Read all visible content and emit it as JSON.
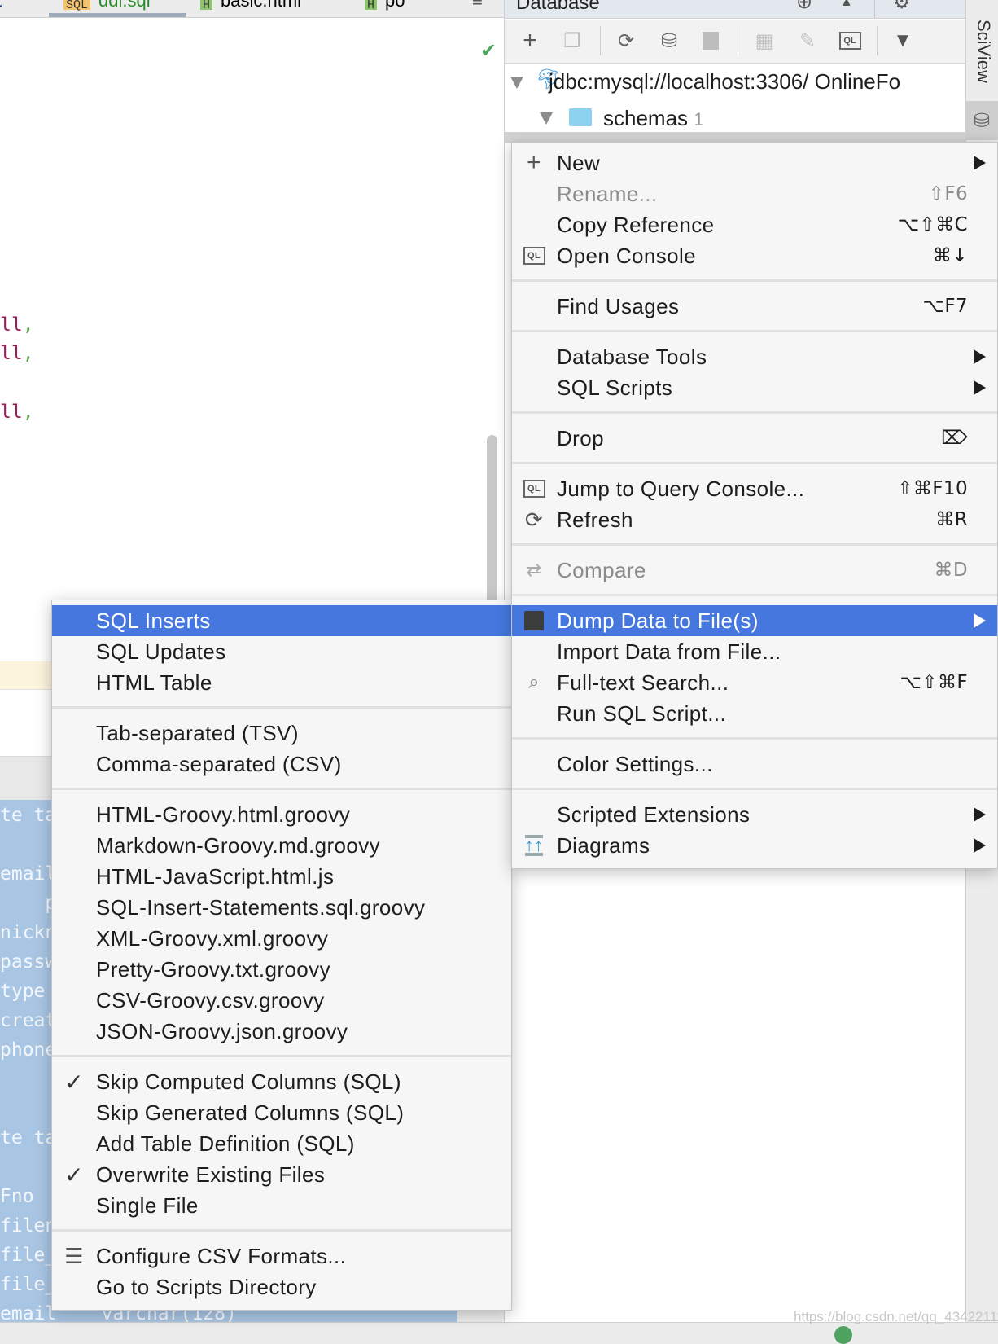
{
  "tabs": [
    {
      "badge": "SQL",
      "label": "ddl.sql",
      "badge_color": "#f5c46d",
      "text_color": "#2a8a2a",
      "active": true
    },
    {
      "badge": "H",
      "label": "basic.html",
      "badge_color": "#8fc46f",
      "text_color": "#222"
    },
    {
      "badge": "H",
      "label": "po",
      "badge_color": "#8fc46f",
      "text_color": "#222"
    }
  ],
  "tab_overflow": "≡",
  "editor": {
    "fragments": [
      {
        "kw": "ll",
        "punct": ","
      },
      {
        "kw": "ll",
        "punct": ","
      },
      {
        "kw": "ll",
        "punct": ","
      }
    ],
    "selected_lines": [
      "te ta",
      "",
      "email",
      "    p",
      "nickn",
      "passw",
      "type",
      "creat",
      "phone",
      "",
      "",
      "te ta",
      "",
      "Fno",
      "filen",
      "file_",
      "file_",
      "email    varchar(128)"
    ]
  },
  "database_panel": {
    "title": "Database",
    "toolbar": [
      "new",
      "duplicate",
      "refresh",
      "db-tools",
      "stop",
      "table-view",
      "edit",
      "query-console",
      "filter"
    ],
    "tree": {
      "connection": "jdbc:mysql://localhost:3306/ OnlineFo",
      "schemas_label": "schemas",
      "schemas_count": "1"
    }
  },
  "side_strip": {
    "sciview": "SciView"
  },
  "context_menu": [
    {
      "label": "New",
      "icon": "plus",
      "submenu": true
    },
    {
      "label": "Rename...",
      "shortcut": "⇧F6",
      "disabled": true
    },
    {
      "label": "Copy Reference",
      "shortcut": "⌥⇧⌘C"
    },
    {
      "label": "Open Console",
      "icon": "ql",
      "shortcut": "⌘↓"
    },
    {
      "sep": true
    },
    {
      "label": "Find Usages",
      "shortcut": "⌥F7"
    },
    {
      "sep": true
    },
    {
      "label": "Database Tools",
      "submenu": true
    },
    {
      "label": "SQL Scripts",
      "submenu": true
    },
    {
      "sep": true
    },
    {
      "label": "Drop",
      "shortcut": "⌦"
    },
    {
      "sep": true
    },
    {
      "label": "Jump to Query Console...",
      "icon": "ql",
      "shortcut": "⇧⌘F10"
    },
    {
      "label": "Refresh",
      "icon": "refresh",
      "shortcut": "⌘R"
    },
    {
      "sep": true
    },
    {
      "label": "Compare",
      "icon": "compare",
      "shortcut": "⌘D",
      "disabled": true
    },
    {
      "sep": true
    },
    {
      "label": "Dump Data to File(s)",
      "icon": "save",
      "submenu": true,
      "highlighted": true
    },
    {
      "label": "Import Data from File..."
    },
    {
      "label": "Full-text Search...",
      "icon": "search",
      "shortcut": "⌥⇧⌘F"
    },
    {
      "label": "Run SQL Script..."
    },
    {
      "sep": true
    },
    {
      "label": "Color Settings..."
    },
    {
      "sep": true
    },
    {
      "label": "Scripted Extensions",
      "submenu": true
    },
    {
      "label": "Diagrams",
      "icon": "diagram",
      "submenu": true
    }
  ],
  "dump_submenu": [
    {
      "label": "SQL Inserts",
      "highlighted": true
    },
    {
      "label": "SQL Updates"
    },
    {
      "label": "HTML Table"
    },
    {
      "sep": true
    },
    {
      "label": "Tab-separated (TSV)"
    },
    {
      "label": "Comma-separated (CSV)"
    },
    {
      "sep": true
    },
    {
      "label": "HTML-Groovy.html.groovy"
    },
    {
      "label": "Markdown-Groovy.md.groovy"
    },
    {
      "label": "HTML-JavaScript.html.js"
    },
    {
      "label": "SQL-Insert-Statements.sql.groovy"
    },
    {
      "label": "XML-Groovy.xml.groovy"
    },
    {
      "label": "Pretty-Groovy.txt.groovy"
    },
    {
      "label": "CSV-Groovy.csv.groovy"
    },
    {
      "label": "JSON-Groovy.json.groovy"
    },
    {
      "sep": true
    },
    {
      "label": "Skip Computed Columns (SQL)",
      "checked": true
    },
    {
      "label": "Skip Generated Columns (SQL)",
      "checked": false
    },
    {
      "label": "Add Table Definition (SQL)",
      "checked": false
    },
    {
      "label": "Overwrite Existing Files",
      "checked": true
    },
    {
      "label": "Single File",
      "checked": false
    },
    {
      "sep": true
    },
    {
      "label": "Configure CSV Formats...",
      "icon": "sliders"
    },
    {
      "label": "Go to Scripts Directory"
    }
  ],
  "watermark": "https://blog.csdn.net/qq_43422111",
  "colors": {
    "highlight": "#4577de",
    "menu_bg": "#f6f6f6",
    "selection": "#a8c5e3"
  }
}
